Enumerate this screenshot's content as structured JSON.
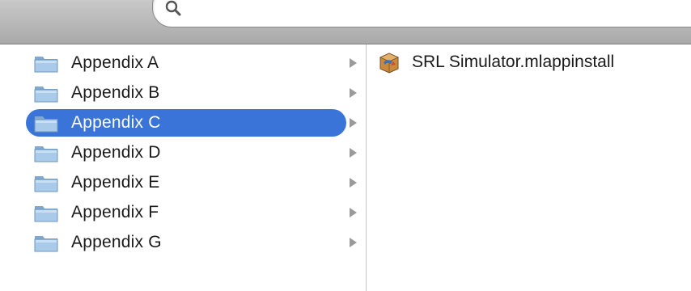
{
  "search": {
    "placeholder": "",
    "value": ""
  },
  "column_left": {
    "items": [
      {
        "label": "Appendix A",
        "selected": false
      },
      {
        "label": "Appendix B",
        "selected": false
      },
      {
        "label": "Appendix C",
        "selected": true
      },
      {
        "label": "Appendix D",
        "selected": false
      },
      {
        "label": "Appendix E",
        "selected": false
      },
      {
        "label": "Appendix F",
        "selected": false
      },
      {
        "label": "Appendix G",
        "selected": false
      }
    ]
  },
  "column_right": {
    "items": [
      {
        "label": "SRL Simulator.mlappinstall",
        "icon": "mlappinstall-package-icon"
      }
    ]
  },
  "colors": {
    "selection": "#3a74d8",
    "folder": "#9cc3e6",
    "toolbar": "#b8b8b8"
  }
}
